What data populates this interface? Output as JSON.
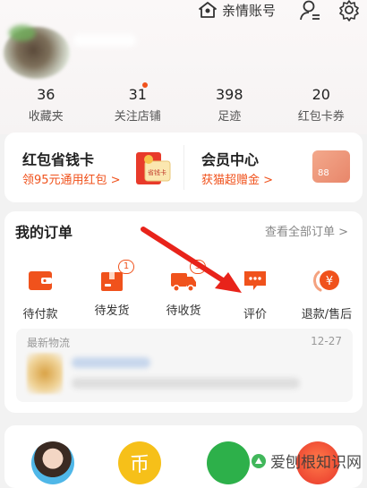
{
  "header": {
    "account_label": "亲情账号"
  },
  "stats": [
    {
      "value": "36",
      "label": "收藏夹"
    },
    {
      "value": "31",
      "label": "关注店铺"
    },
    {
      "value": "398",
      "label": "足迹"
    },
    {
      "value": "20",
      "label": "红包卡券"
    }
  ],
  "promo": {
    "left": {
      "title": "红包省钱卡",
      "subtitle": "领95元通用红包 >",
      "card_text": "省钱卡"
    },
    "right": {
      "title": "会员中心",
      "subtitle": "获猫超赠金 >",
      "card_text": "88"
    }
  },
  "orders": {
    "title": "我的订单",
    "view_all": "查看全部订单 >",
    "items": [
      {
        "label": "待付款",
        "icon": "wallet-icon",
        "badge": ""
      },
      {
        "label": "待发货",
        "icon": "box-icon",
        "badge": "1"
      },
      {
        "label": "待收货",
        "icon": "truck-icon",
        "badge": "3"
      },
      {
        "label": "评价",
        "icon": "comment-icon",
        "badge": ""
      },
      {
        "label": "退款/售后",
        "icon": "refund-icon",
        "badge": ""
      }
    ],
    "logistics": {
      "title": "最新物流",
      "date": "12-27"
    }
  },
  "watermark": "爱刨根知识网",
  "colors": {
    "accent": "#f0521c",
    "arrow": "#e8231a"
  }
}
